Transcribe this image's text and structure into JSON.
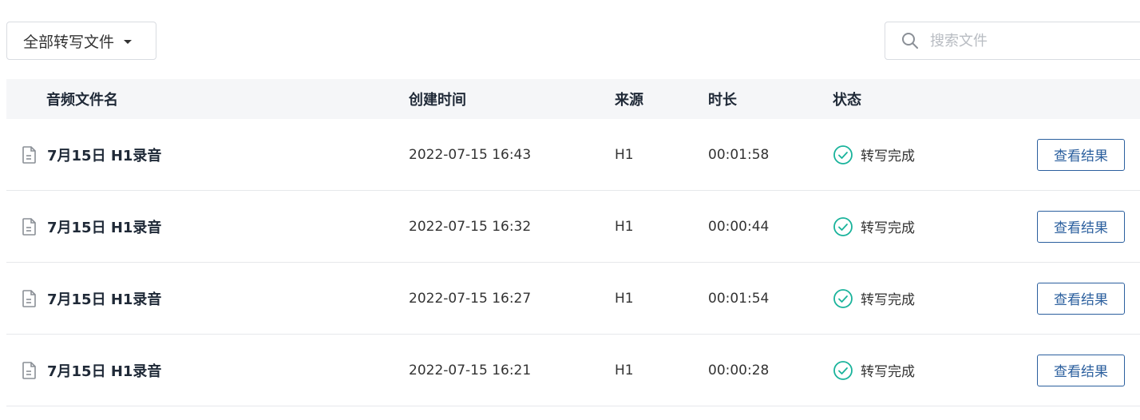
{
  "toolbar": {
    "filter_label": "全部转写文件",
    "search_placeholder": "搜索文件"
  },
  "table": {
    "headers": {
      "name": "音频文件名",
      "created": "创建时间",
      "source": "来源",
      "duration": "时长",
      "status": "状态"
    },
    "rows": [
      {
        "name": "7月15日 H1录音",
        "created": "2022-07-15 16:43",
        "source": "H1",
        "duration": "00:01:58",
        "status": "转写完成",
        "action": "查看结果"
      },
      {
        "name": "7月15日 H1录音",
        "created": "2022-07-15 16:32",
        "source": "H1",
        "duration": "00:00:44",
        "status": "转写完成",
        "action": "查看结果"
      },
      {
        "name": "7月15日 H1录音",
        "created": "2022-07-15 16:27",
        "source": "H1",
        "duration": "00:01:54",
        "status": "转写完成",
        "action": "查看结果"
      },
      {
        "name": "7月15日 H1录音",
        "created": "2022-07-15 16:21",
        "source": "H1",
        "duration": "00:00:28",
        "status": "转写完成",
        "action": "查看结果"
      }
    ]
  },
  "colors": {
    "accent": "#2b5f9e",
    "success": "#19b39b",
    "header_bg": "#f5f6f8"
  },
  "icons": {
    "file": "file-icon",
    "status": "check-circle-icon",
    "search": "search-icon",
    "dropdown": "caret-down-icon"
  }
}
